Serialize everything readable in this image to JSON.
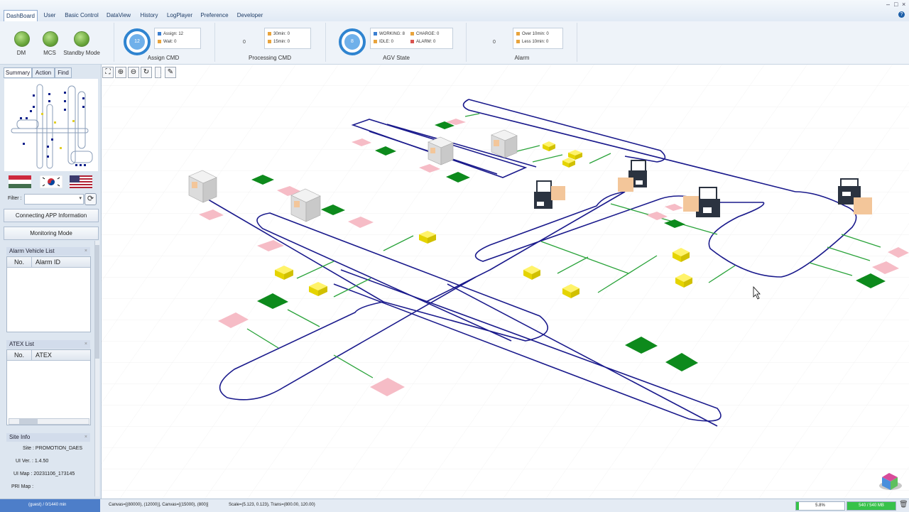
{
  "window": {
    "minimize": "–",
    "maximize": "□",
    "close": "×"
  },
  "menu": {
    "tabs": [
      "DashBoard",
      "User",
      "Basic Control",
      "DataView",
      "History",
      "LogPlayer",
      "Preference",
      "Developer"
    ],
    "help": "?"
  },
  "dashboard": {
    "lamps": [
      {
        "label": "DM"
      },
      {
        "label": "MCS"
      },
      {
        "label": "Standby Mode"
      }
    ],
    "assign_cmd": {
      "label": "Assign CMD",
      "count": "12",
      "assign": "Assign: 12",
      "wait": "Wait: 0"
    },
    "processing_cmd": {
      "label": "Processing CMD",
      "count": "0",
      "min30": "30min: 0",
      "min15": "15min: 0"
    },
    "agv_state": {
      "label": "AGV State",
      "count": "8",
      "working": "WORKING: 8",
      "charge": "CHARGE: 0",
      "idle": "IDLE: 0",
      "alarm": "ALARM: 0"
    },
    "alarm": {
      "label": "Alarm",
      "count": "0",
      "over10": "Over 10min: 0",
      "less10": "Less 10min: 0"
    },
    "colors": {
      "blue": "#3b7fd0",
      "orange": "#e8a33c",
      "red": "#d9534f",
      "green_lamp": "#6aa73c",
      "ring": "#2f84d0"
    }
  },
  "left_panel": {
    "tabs": [
      "Summary",
      "Action",
      "Find"
    ],
    "filter_label": "Filter :",
    "filter_value": "",
    "buttons": {
      "connecting": "Connecting APP Information",
      "monitoring": "Monitoring Mode"
    },
    "alarm_vehicle_list": {
      "title": "Alarm Vehicle List",
      "close": "×",
      "headers": [
        "No.",
        "Alarm ID"
      ]
    },
    "atex_list": {
      "title": "ATEX List",
      "close": "×",
      "headers": [
        "No.",
        "ATEX"
      ]
    },
    "site_info": {
      "title": "Site Info",
      "close": "×",
      "site": "Site : PROMOTION_DAES",
      "ui_ver": "UI Ver. : 1.4.50",
      "ui_map": "UI Map : 20231106_173145",
      "pri_map": "PRI Map :"
    }
  },
  "toolbar": {
    "icons": [
      "fit-screen-icon",
      "zoom-in-icon",
      "zoom-out-icon",
      "refresh-icon",
      "blank-icon",
      "pen-icon"
    ]
  },
  "status_bar": {
    "user": "(guest) / 0/1440 min",
    "canvas": "Canvas=[(80000), (12000)], Canvas=[(15000), (800)]",
    "scale": "Scale=(5.123, 0.123), Trans=(800.00, 120.00)",
    "cpu": "5.8%",
    "cpu_fraction": 0.058,
    "memory": "540 / 540 MB",
    "memory_fraction": 1.0
  }
}
